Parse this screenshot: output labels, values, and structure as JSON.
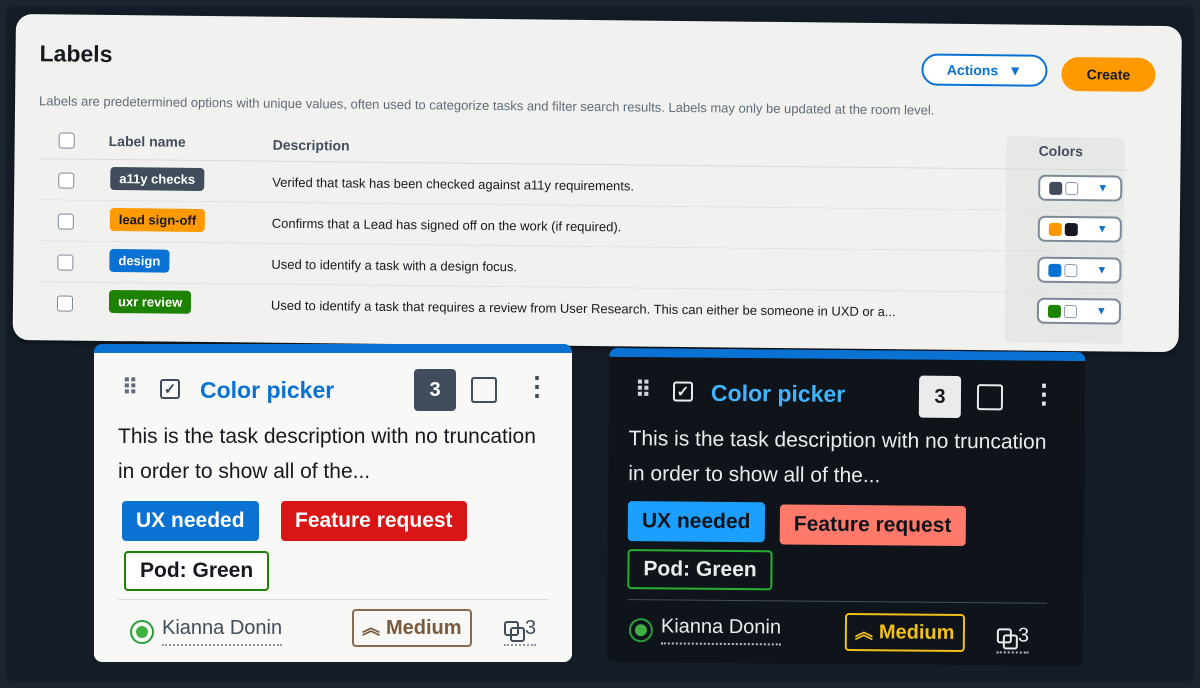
{
  "labels_panel": {
    "title": "Labels",
    "description": "Labels are predetermined options with unique values, often used to categorize tasks and filter search results. Labels may only be updated at the room level.",
    "actions_label": "Actions",
    "create_label": "Create",
    "columns": {
      "name": "Label name",
      "description": "Description",
      "colors": "Colors"
    },
    "rows": [
      {
        "label": "a11y checks",
        "label_color": "#414d5c",
        "description": "Verifed that task has been checked against a11y requirements.",
        "swatch_primary": "#414d5c",
        "swatch_secondary": "#ffffff"
      },
      {
        "label": "lead sign-off",
        "label_color": "#ff9900",
        "description": "Confirms that a Lead has signed off on the work (if required).",
        "swatch_primary": "#ff9900",
        "swatch_secondary": "#16191f"
      },
      {
        "label": "design",
        "label_color": "#0972d3",
        "description": "Used to identify a task with a design focus.",
        "swatch_primary": "#0972d3",
        "swatch_secondary": "#ffffff"
      },
      {
        "label": "uxr review",
        "label_color": "#1d8102",
        "description": "Used to identify a task that requires a review from User Research. This can either be someone in UXD or a...",
        "swatch_primary": "#1d8102",
        "swatch_secondary": "#ffffff"
      }
    ]
  },
  "cards": [
    {
      "theme": "light",
      "title": "Color picker",
      "count": "3",
      "description": "This is the task description with no truncation in order to show all of the...",
      "tags": [
        {
          "label": "UX needed",
          "color": "#0972d3"
        },
        {
          "label": "Feature request",
          "color": "#d91515"
        },
        {
          "label": "Pod: Green",
          "color": "#1d8102"
        }
      ],
      "assignee": "Kianna Donin",
      "priority": "Medium",
      "subtasks": "3"
    },
    {
      "theme": "dark",
      "title": "Color picker",
      "count": "3",
      "description": "This is the task description with no truncation in order to show all of the...",
      "tags": [
        {
          "label": "UX needed",
          "color": "#1c9fff"
        },
        {
          "label": "Feature request",
          "color": "#ff7a6b"
        },
        {
          "label": "Pod: Green",
          "color": "#29ad32"
        }
      ],
      "assignee": "Kianna Donin",
      "priority": "Medium",
      "subtasks": "3"
    }
  ],
  "icons": [
    "drag-handle-icon",
    "checkbox-checked-icon",
    "kebab-menu-icon",
    "chevron-double-up-icon",
    "subtasks-icon",
    "caret-down-icon",
    "avatar-icon"
  ]
}
